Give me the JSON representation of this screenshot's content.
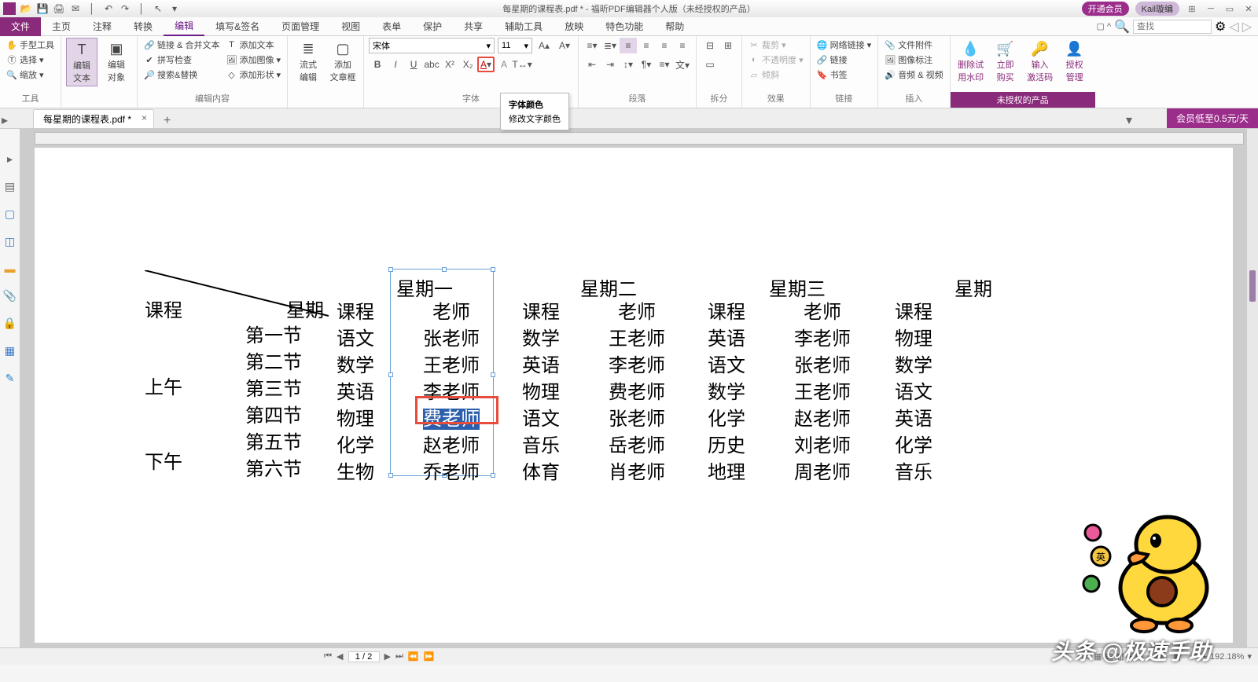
{
  "title": "每星期的课程表.pdf * - 福昕PDF编辑器个人版（未经授权的产品）",
  "qat_icons": [
    "logo",
    "open",
    "save",
    "print",
    "mail",
    "spacer",
    "undo",
    "redo",
    "spacer",
    "hand",
    "dd"
  ],
  "titleright": {
    "pill1": "开通会员",
    "pill2": "Kail璇编"
  },
  "menu": {
    "file": "文件",
    "items": [
      "主页",
      "注释",
      "转换",
      "编辑",
      "填写&签名",
      "页面管理",
      "视图",
      "表单",
      "保护",
      "共享",
      "辅助工具",
      "放映",
      "特色功能",
      "帮助"
    ],
    "active": 3
  },
  "search_placeholder": "查找",
  "ribbon": {
    "g1": {
      "label": "工具",
      "items": [
        "手型工具",
        "选择 ▾",
        "缩放 ▾"
      ]
    },
    "g2": {
      "label": "",
      "big1": "编辑\n文本",
      "big2": "编辑\n对象"
    },
    "g3": {
      "label": "编辑内容",
      "items": [
        "链接 & 合并文本",
        "拼写检查",
        "搜索&替换"
      ],
      "items2": [
        "添加文本",
        "添加图像 ▾",
        "添加形状 ▾"
      ]
    },
    "g4": {
      "label": "",
      "big1": "流式\n编辑",
      "big2": "添加\n文章框"
    },
    "g5": {
      "label": "字体",
      "font": "宋体",
      "size": "11"
    },
    "g6": {
      "label": "段落"
    },
    "g7": {
      "label": "拆分"
    },
    "g8": {
      "label": "效果",
      "items": [
        "裁剪 ▾",
        "不透明度 ▾",
        "倾斜"
      ]
    },
    "g9": {
      "label": "链接",
      "items": [
        "网络链接 ▾",
        "链接",
        "书签"
      ]
    },
    "g10": {
      "label": "插入",
      "items": [
        "文件附件",
        "图像标注",
        "音频 & 视频"
      ]
    },
    "g11": {
      "label": "未授权的产品",
      "b1": "删除试\n用水印",
      "b2": "立即\n购买",
      "b3": "输入\n激活码",
      "b4": "授权\n管理"
    }
  },
  "tooltip": {
    "title": "字体颜色",
    "desc": "修改文字颜色"
  },
  "tab": {
    "name": "每星期的课程表.pdf *"
  },
  "promo": "会员低至0.5元/天",
  "table": {
    "corner_top": "星期",
    "corner_bot": "课程",
    "rowh": [
      "",
      "第一节",
      "第二节",
      "第三节",
      "第四节",
      "第五节",
      "第六节"
    ],
    "periods_top": "上午",
    "periods_bot": "下午",
    "heads": [
      "星期一",
      "星期二",
      "星期三",
      "星期"
    ],
    "sub": [
      "课程",
      "老师",
      "课程",
      "老师",
      "课程",
      "老师",
      "课程"
    ],
    "c1": [
      "语文",
      "数学",
      "英语",
      "物理",
      "化学",
      "生物"
    ],
    "t1": [
      "张老师",
      "王老师",
      "李老师",
      "费老师",
      "赵老师",
      "乔老师"
    ],
    "c2": [
      "数学",
      "英语",
      "物理",
      "语文",
      "音乐",
      "体育"
    ],
    "t2": [
      "王老师",
      "李老师",
      "费老师",
      "张老师",
      "岳老师",
      "肖老师"
    ],
    "c3": [
      "英语",
      "语文",
      "数学",
      "化学",
      "历史",
      "地理"
    ],
    "t3": [
      "李老师",
      "张老师",
      "王老师",
      "赵老师",
      "刘老师",
      "周老师"
    ],
    "c4": [
      "物理",
      "数学",
      "语文",
      "英语",
      "化学",
      "音乐"
    ]
  },
  "status": {
    "page": "1 / 2",
    "zoom": "192.18%"
  },
  "watermark": "头条 @极速手助"
}
